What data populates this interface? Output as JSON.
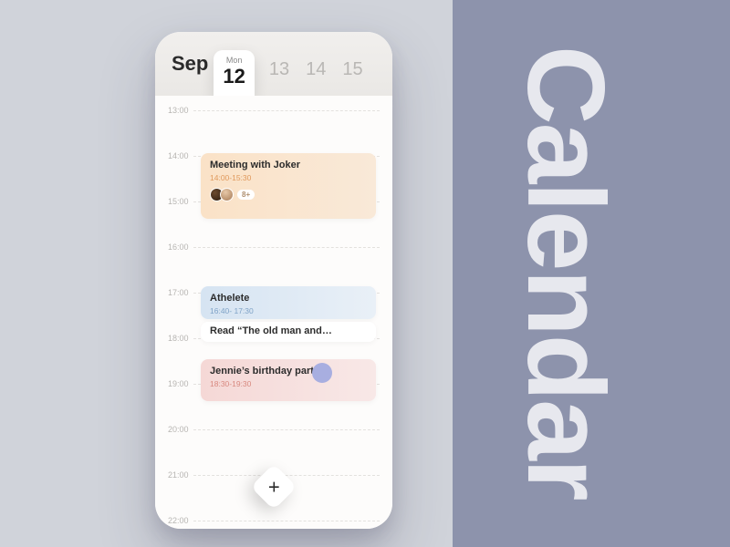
{
  "decor": {
    "big_title": "Calendar"
  },
  "header": {
    "month": "Sep",
    "selected": {
      "dow": "Mon",
      "num": "12"
    },
    "others": [
      "13",
      "14",
      "15"
    ]
  },
  "hours": [
    "13:00",
    "14:00",
    "15:00",
    "16:00",
    "17:00",
    "18:00",
    "19:00",
    "20:00",
    "21:00",
    "22:00"
  ],
  "events": {
    "meeting": {
      "title": "Meeting with Joker",
      "time": "14:00-15:30",
      "more": "8+"
    },
    "athlete": {
      "title": "Athelete",
      "time": "16:40- 17:30"
    },
    "read": {
      "title": "Read “The old man and…"
    },
    "birthday": {
      "title": "Jennie’s birthday party",
      "time": "18:30-19:30"
    }
  },
  "fab": {
    "glyph": "+"
  }
}
